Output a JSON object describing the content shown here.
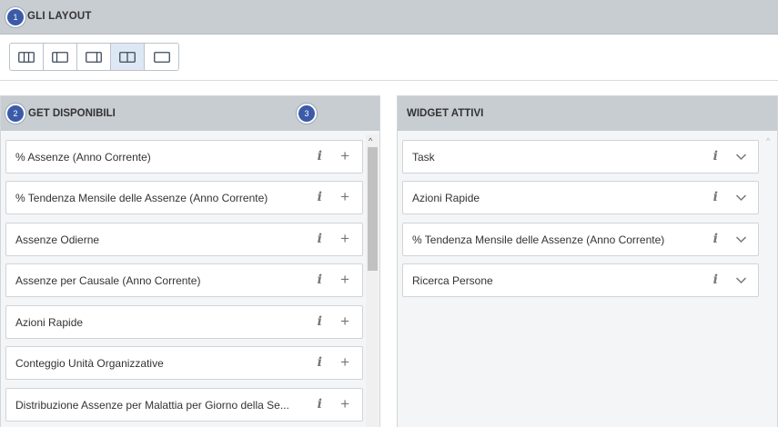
{
  "layout_section": {
    "title": "GLI LAYOUT",
    "buttons": [
      {
        "icon": "layout-three-columns-icon",
        "active": false
      },
      {
        "icon": "layout-left-sidebar-icon",
        "active": false
      },
      {
        "icon": "layout-right-sidebar-icon",
        "active": false
      },
      {
        "icon": "layout-two-columns-icon",
        "active": true
      },
      {
        "icon": "layout-single-column-icon",
        "active": false
      }
    ]
  },
  "available_widgets": {
    "title": "GET DISPONIBILI",
    "items": [
      {
        "label": "% Assenze (Anno Corrente)"
      },
      {
        "label": "% Tendenza Mensile delle Assenze (Anno Corrente)"
      },
      {
        "label": "Assenze Odierne"
      },
      {
        "label": "Assenze per Causale (Anno Corrente)"
      },
      {
        "label": "Azioni Rapide"
      },
      {
        "label": "Conteggio Unità Organizzative"
      },
      {
        "label": "Distribuzione Assenze per Malattia per Giorno della Se..."
      }
    ]
  },
  "active_widgets": {
    "title": "WIDGET ATTIVI",
    "items": [
      {
        "label": "Task"
      },
      {
        "label": "Azioni Rapide"
      },
      {
        "label": "% Tendenza Mensile delle Assenze (Anno Corrente)"
      },
      {
        "label": "Ricerca Persone"
      }
    ]
  },
  "icons": {
    "info": "i",
    "add": "+",
    "scroll_up": "^"
  },
  "markers": [
    "1",
    "2",
    "3"
  ],
  "colors": {
    "header_bg": "#c8cdd2",
    "active_layout_bg": "#dde8f4",
    "marker": "#3b5ba8"
  }
}
